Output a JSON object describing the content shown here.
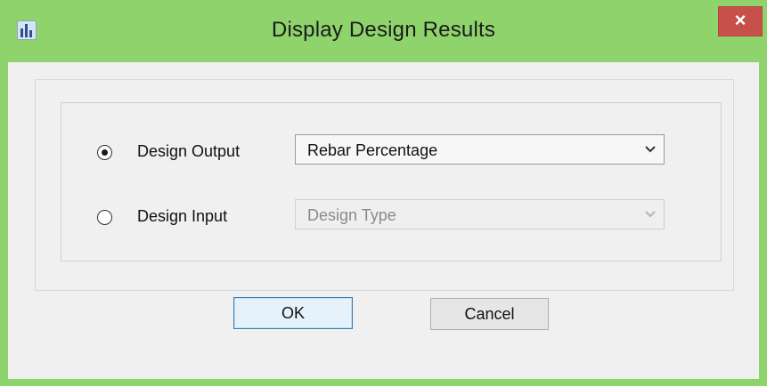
{
  "window": {
    "title": "Display Design Results",
    "close_symbol": "×",
    "app_icon": "bar-chart-icon",
    "colors": {
      "frame": "#8fd36c",
      "close": "#c7504b",
      "client": "#f0f0f0"
    }
  },
  "options": {
    "design_output": {
      "label": "Design Output",
      "selected": true,
      "select_value": "Rebar Percentage",
      "enabled": true
    },
    "design_input": {
      "label": "Design Input",
      "selected": false,
      "select_value": "Design Type",
      "enabled": false
    }
  },
  "buttons": {
    "ok": "OK",
    "cancel": "Cancel"
  }
}
